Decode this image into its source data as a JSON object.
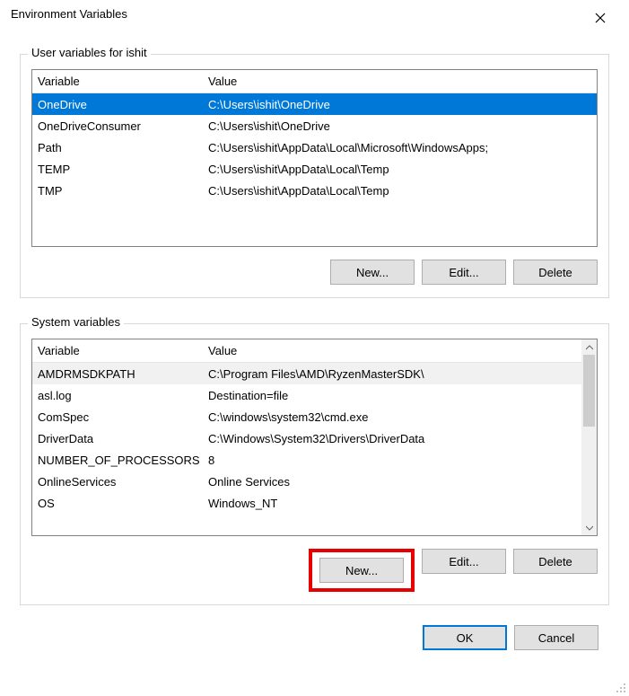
{
  "window": {
    "title": "Environment Variables"
  },
  "userSection": {
    "label": "User variables for ishit",
    "headers": {
      "variable": "Variable",
      "value": "Value"
    },
    "rows": [
      {
        "variable": "OneDrive",
        "value": "C:\\Users\\ishit\\OneDrive",
        "selected": true
      },
      {
        "variable": "OneDriveConsumer",
        "value": "C:\\Users\\ishit\\OneDrive"
      },
      {
        "variable": "Path",
        "value": "C:\\Users\\ishit\\AppData\\Local\\Microsoft\\WindowsApps;"
      },
      {
        "variable": "TEMP",
        "value": "C:\\Users\\ishit\\AppData\\Local\\Temp"
      },
      {
        "variable": "TMP",
        "value": "C:\\Users\\ishit\\AppData\\Local\\Temp"
      }
    ],
    "buttons": {
      "new": "New...",
      "edit": "Edit...",
      "delete": "Delete"
    }
  },
  "systemSection": {
    "label": "System variables",
    "headers": {
      "variable": "Variable",
      "value": "Value"
    },
    "rows": [
      {
        "variable": "AMDRMSDKPATH",
        "value": "C:\\Program Files\\AMD\\RyzenMasterSDK\\",
        "hi": true
      },
      {
        "variable": "asl.log",
        "value": "Destination=file"
      },
      {
        "variable": "ComSpec",
        "value": "C:\\windows\\system32\\cmd.exe"
      },
      {
        "variable": "DriverData",
        "value": "C:\\Windows\\System32\\Drivers\\DriverData"
      },
      {
        "variable": "NUMBER_OF_PROCESSORS",
        "value": "8"
      },
      {
        "variable": "OnlineServices",
        "value": "Online Services"
      },
      {
        "variable": "OS",
        "value": "Windows_NT"
      }
    ],
    "buttons": {
      "new": "New...",
      "edit": "Edit...",
      "delete": "Delete"
    }
  },
  "dialogButtons": {
    "ok": "OK",
    "cancel": "Cancel"
  }
}
